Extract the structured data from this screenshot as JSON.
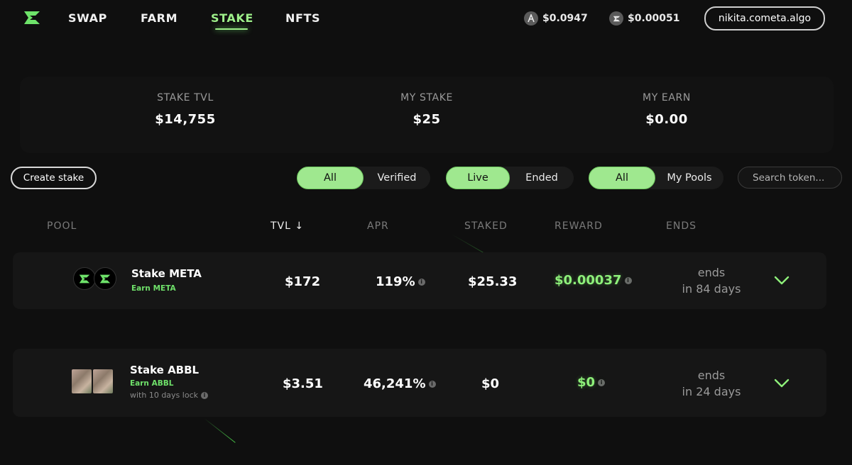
{
  "nav": {
    "items": [
      "SWAP",
      "FARM",
      "STAKE",
      "NFTS"
    ],
    "active": "STAKE"
  },
  "prices": [
    {
      "icon": "algo-icon",
      "value": "$0.0947"
    },
    {
      "icon": "cometa-icon",
      "value": "$0.00051"
    }
  ],
  "wallet": {
    "label": "nikita.cometa.algo"
  },
  "stats": [
    {
      "label": "STAKE TVL",
      "value": "$14,755"
    },
    {
      "label": "MY STAKE",
      "value": "$25"
    },
    {
      "label": "MY EARN",
      "value": "$0.00"
    }
  ],
  "filters": {
    "create_label": "Create stake",
    "group1": [
      "All",
      "Verified"
    ],
    "group2": [
      "Live",
      "Ended"
    ],
    "group3": [
      "All",
      "My Pools"
    ],
    "search_placeholder": "Search token..."
  },
  "table": {
    "headers": {
      "pool": "POOL",
      "tvl": "TVL ↓",
      "apr": "APR",
      "staked": "STAKED",
      "reward": "REWARD",
      "ends": "ENDS"
    },
    "rows": [
      {
        "name": "Stake META",
        "earn": "Earn META",
        "lock": "",
        "tvl": "$172",
        "apr": "119%",
        "staked": "$25.33",
        "reward": "$0.00037",
        "ends_line1": "ends",
        "ends_line2": "in 84 days"
      },
      {
        "name": "Stake ABBL",
        "earn": "Earn ABBL",
        "lock": "with 10 days lock",
        "tvl": "$3.51",
        "apr": "46,241%",
        "staked": "$0",
        "reward": "$0",
        "ends_line1": "ends",
        "ends_line2": "in 24 days"
      }
    ]
  },
  "colors": {
    "accent": "#9ef08a",
    "background": "#0f0f0f",
    "reward": "#8ef07a"
  }
}
